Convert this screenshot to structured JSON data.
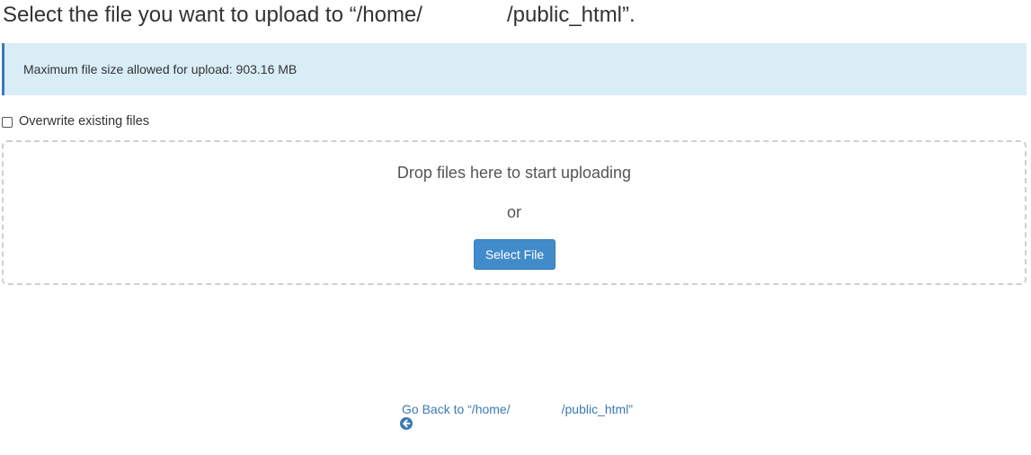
{
  "page": {
    "heading_prefix": "Select the file you want to upload to “/home/",
    "heading_suffix": "/public_html”."
  },
  "info": {
    "max_size_text": "Maximum file size allowed for upload: 903.16 MB"
  },
  "options": {
    "overwrite_label": "Overwrite existing files",
    "overwrite_checked": false
  },
  "dropzone": {
    "drop_text": "Drop files here to start uploading",
    "or_text": "or",
    "select_button_label": "Select File"
  },
  "footer": {
    "back_icon": "circle-arrow-left-icon",
    "back_prefix": "Go Back to “/home/",
    "back_suffix": "/public_html”"
  },
  "colors": {
    "info_bg": "#d9edf7",
    "info_border": "#3c79b4",
    "button_bg": "#428bca",
    "link": "#3c79b4"
  }
}
